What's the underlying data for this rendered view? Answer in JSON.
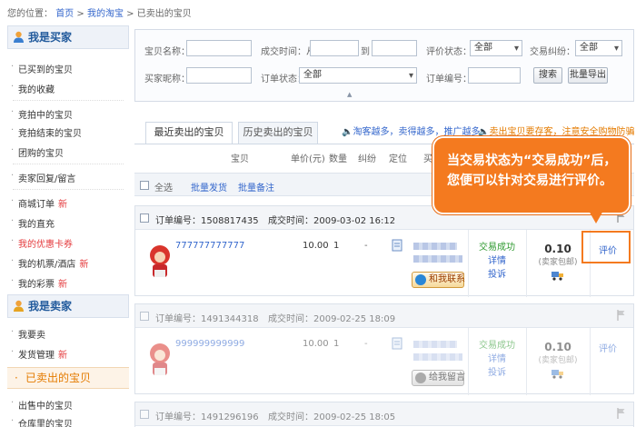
{
  "breadcrumb": {
    "prefix": "您的位置：",
    "items": [
      "首页",
      "我的淘宝",
      "已卖出的宝贝"
    ],
    "sep": ">"
  },
  "sidebar": {
    "buyer_title": "我是买家",
    "buyer_items": [
      {
        "label": "已买到的宝贝"
      },
      {
        "label": "我的收藏"
      },
      {
        "label": "竞拍中的宝贝"
      },
      {
        "label": "竞拍结束的宝贝"
      },
      {
        "label": "团购的宝贝"
      },
      {
        "label": "卖家回复/留言"
      },
      {
        "label": "商城订单",
        "badge": "新"
      },
      {
        "label": "我的直充"
      },
      {
        "label": "我的优惠卡券"
      },
      {
        "label": "我的机票/酒店",
        "badge": "新"
      },
      {
        "label": "我的彩票",
        "badge": "新"
      }
    ],
    "seller_title": "我是卖家",
    "seller_items": [
      {
        "label": "我要卖"
      },
      {
        "label": "发货管理",
        "badge": "新"
      }
    ],
    "active_item": "已卖出的宝贝",
    "after_items": [
      {
        "label": "出售中的宝贝"
      },
      {
        "label": "仓库里的宝贝"
      }
    ]
  },
  "search": {
    "item_name_label": "宝贝名称：",
    "deal_time_label": "成交时间：从",
    "to_label": "到",
    "review_status_label": "评价状态：",
    "review_status_value": "全部",
    "dispute_label": "交易纠纷：",
    "dispute_value": "全部",
    "buyer_nick_label": "买家昵称：",
    "order_status_label": "订单状态：",
    "order_status_value": "全部",
    "order_no_label": "订单编号：",
    "search_button": "搜索",
    "export_button": "批量导出"
  },
  "tabs": [
    {
      "label": "最近卖出的宝贝",
      "active": true
    },
    {
      "label": "历史卖出的宝贝",
      "active": false
    }
  ],
  "notices": [
    {
      "text": "淘客越多，卖得越多，推广越多"
    },
    {
      "text": "卖出宝贝要存客，注意安全购物防骗"
    }
  ],
  "table_headers": [
    "宝贝",
    "单价(元)",
    "数量",
    "纠纷",
    "定位",
    "买"
  ],
  "bulk": {
    "select_all": "全选",
    "bulk_ship": "批量发货",
    "bulk_note": "批量备注"
  },
  "orders": [
    {
      "order_no": "订单编号：1508817435",
      "deal_time": "成交时间：2009-03-02 16:12",
      "item_name": "777777777777",
      "price": "10.00",
      "qty": "1",
      "dispute": "-",
      "contact": "和我联系",
      "status": "交易成功",
      "detail": "详情",
      "complain": "投诉",
      "amount": "0.10",
      "shipping": "(卖家包邮)",
      "review": "评价",
      "faded": false
    },
    {
      "order_no": "订单编号：1491344318",
      "deal_time": "成交时间：2009-02-25 18:09",
      "item_name": "999999999999",
      "price": "10.00",
      "qty": "1",
      "dispute": "-",
      "contact": "给我留言",
      "status": "交易成功",
      "detail": "详情",
      "complain": "投诉",
      "amount": "0.10",
      "shipping": "(卖家包邮)",
      "review": "评价",
      "faded": true
    },
    {
      "order_no": "订单编号：1491296196",
      "deal_time": "成交时间：2009-02-25 18:05",
      "faded": true
    }
  ],
  "callout": {
    "line1": "当交易状态为“交易成功”后，",
    "line2": "您便可以针对交易进行评价。"
  },
  "colors": {
    "accent_orange": "#f47a1f",
    "link_blue": "#3366cc",
    "success_green": "#2f9a30"
  }
}
